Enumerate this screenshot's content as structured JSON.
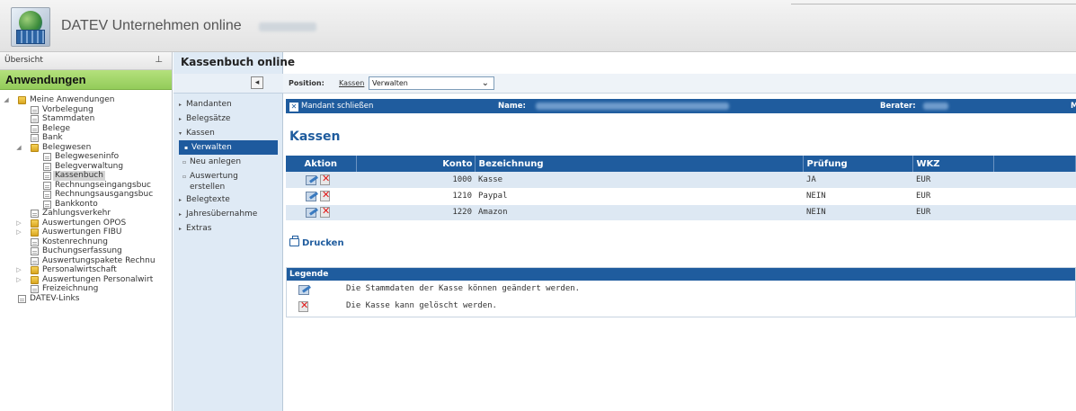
{
  "header": {
    "app_title": "DATEV Unternehmen online"
  },
  "left_panel": {
    "overview_label": "Übersicht",
    "section_title": "Anwendungen",
    "tree": [
      {
        "label": "Meine Anwendungen",
        "level": 0,
        "icon": "folder-icon",
        "expanded": true
      },
      {
        "label": "Vorbelegung",
        "level": 1,
        "icon": "document-icon"
      },
      {
        "label": "Stammdaten",
        "level": 1,
        "icon": "document-icon"
      },
      {
        "label": "Belege",
        "level": 1,
        "icon": "document-icon"
      },
      {
        "label": "Bank",
        "level": 1,
        "icon": "document-icon"
      },
      {
        "label": "Belegwesen",
        "level": 1,
        "icon": "folder-icon",
        "expanded": true
      },
      {
        "label": "Belegweseninfo",
        "level": 2,
        "icon": "document-icon"
      },
      {
        "label": "Belegverwaltung",
        "level": 2,
        "icon": "document-icon"
      },
      {
        "label": "Kassenbuch",
        "level": 2,
        "icon": "document-icon",
        "selected": true
      },
      {
        "label": "Rechnungseingangsbuc",
        "level": 2,
        "icon": "document-icon"
      },
      {
        "label": "Rechnungsausgangsbuc",
        "level": 2,
        "icon": "document-icon"
      },
      {
        "label": "Bankkonto",
        "level": 2,
        "icon": "document-icon"
      },
      {
        "label": "Zahlungsverkehr",
        "level": 1,
        "icon": "document-icon"
      },
      {
        "label": "Auswertungen OPOS",
        "level": 1,
        "icon": "folder-icon",
        "expandable": true
      },
      {
        "label": "Auswertungen FIBU",
        "level": 1,
        "icon": "folder-icon",
        "expandable": true
      },
      {
        "label": "Kostenrechnung",
        "level": 1,
        "icon": "document-icon"
      },
      {
        "label": "Buchungserfassung",
        "level": 1,
        "icon": "document-icon"
      },
      {
        "label": "Auswertungspakete Rechnu",
        "level": 1,
        "icon": "document-icon"
      },
      {
        "label": "Personalwirtschaft",
        "level": 1,
        "icon": "folder-icon",
        "expandable": true
      },
      {
        "label": "Auswertungen Personalwirt",
        "level": 1,
        "icon": "folder-icon",
        "expandable": true
      },
      {
        "label": "Freizeichnung",
        "level": 1,
        "icon": "document-icon"
      },
      {
        "label": "DATEV-Links",
        "level": 0,
        "icon": "document-icon"
      }
    ]
  },
  "mid_nav": {
    "title": "Kassenbuch online",
    "items": [
      {
        "label": "Mandanten",
        "marker": "▸"
      },
      {
        "label": "Belegsätze",
        "marker": "▸"
      },
      {
        "label": "Kassen",
        "marker": "▾"
      },
      {
        "label": "Verwalten",
        "marker": "▪",
        "sub": true,
        "active": true
      },
      {
        "label": "Neu anlegen",
        "marker": "▫",
        "sub": true
      },
      {
        "label": "Auswertung\nerstellen",
        "marker": "▫",
        "sub": true,
        "multi": true
      },
      {
        "label": "Belegtexte",
        "marker": "▸"
      },
      {
        "label": "Jahresübernahme",
        "marker": "▸"
      },
      {
        "label": "Extras",
        "marker": "▸"
      }
    ]
  },
  "position": {
    "label": "Position:",
    "link": "Kassen",
    "select_value": "Verwalten"
  },
  "mandant_bar": {
    "close_label": "Mandant schließen",
    "name_label": "Name:",
    "berater_label": "Berater:",
    "trailing": "M"
  },
  "kassen": {
    "heading": "Kassen",
    "columns": {
      "aktion": "Aktion",
      "konto": "Konto",
      "bezeichnung": "Bezeichnung",
      "pruefung": "Prüfung",
      "wkz": "WKZ"
    },
    "rows": [
      {
        "konto": "1000",
        "bezeichnung": "Kasse",
        "pruefung": "JA",
        "wkz": "EUR"
      },
      {
        "konto": "1210",
        "bezeichnung": "Paypal",
        "pruefung": "NEIN",
        "wkz": "EUR"
      },
      {
        "konto": "1220",
        "bezeichnung": "Amazon",
        "pruefung": "NEIN",
        "wkz": "EUR"
      }
    ],
    "print_label": "Drucken"
  },
  "legend": {
    "title": "Legende",
    "edit_text": "Die Stammdaten der Kasse können geändert werden.",
    "delete_text": "Die Kasse kann gelöscht werden."
  },
  "colors": {
    "brand_blue": "#1f5c9e",
    "apps_green": "#93cc5a",
    "row_tint": "#dde8f3"
  }
}
